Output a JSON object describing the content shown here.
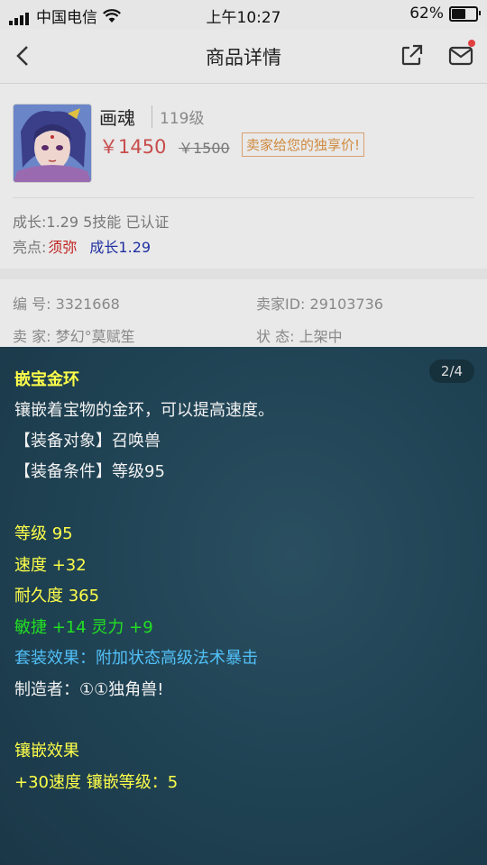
{
  "status_bar": {
    "carrier": "中国电信",
    "time": "上午10:27",
    "battery": "62%",
    "battery_level": 0.62
  },
  "nav": {
    "title": "商品详情"
  },
  "product": {
    "name": "画魂",
    "level": "119级",
    "price": "￥1450",
    "original_price": "￥1500",
    "exclusive_label": "卖家给您的独享价!",
    "attributes": "成长:1.29 5技能 已认证",
    "highlight_label": "亮点:",
    "highlight_1": "须弥",
    "highlight_2": "成长1.29"
  },
  "info": {
    "id_label": "编 号:",
    "id_value": "3321668",
    "seller_id_label": "卖家ID:",
    "seller_id_value": "29103736",
    "seller_label": "卖 家:",
    "seller_value": "梦幻°莫赋笙",
    "state_label": "状 态:",
    "state_value": "上架中"
  },
  "equipment": {
    "page_indicator": "2/4",
    "name": "嵌宝金环",
    "description": "镶嵌着宝物的金环，可以提高速度。",
    "target": "【装备对象】召唤兽",
    "requirement": "【装备条件】等级95",
    "level": "等级 95",
    "speed": "速度 +32",
    "durability": "耐久度 365",
    "bonus": "敏捷 +14 灵力 +9",
    "set_effect": "套装效果：附加状态高级法术暴击",
    "maker": "制造者：①①独角兽!",
    "inlay_title": "镶嵌效果",
    "inlay_effect": "+30速度 镶嵌等级：5"
  },
  "colors": {
    "panel_bg": "#1f4253",
    "yellow_text": "#ffff4a",
    "green_text": "#22e022",
    "blue_text": "#52c0f8",
    "price_red": "#c84c4c"
  }
}
